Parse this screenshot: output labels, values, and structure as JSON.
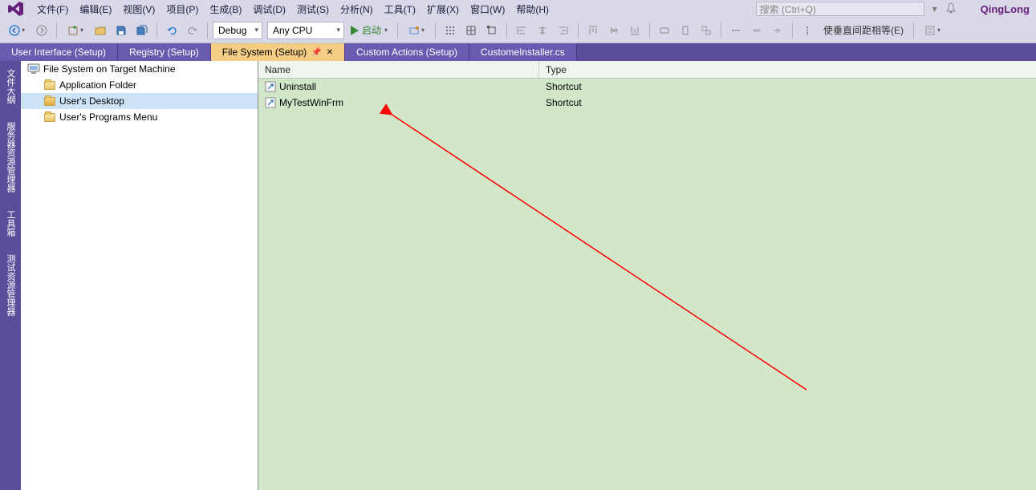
{
  "menu": {
    "items": [
      "文件(F)",
      "编辑(E)",
      "视图(V)",
      "项目(P)",
      "生成(B)",
      "调试(D)",
      "测试(S)",
      "分析(N)",
      "工具(T)",
      "扩展(X)",
      "窗口(W)",
      "帮助(H)"
    ],
    "search_placeholder": "搜索 (Ctrl+Q)",
    "user": "QingLong"
  },
  "toolbar": {
    "config": "Debug",
    "platform": "Any CPU",
    "start": "启动",
    "align_label": "使垂直间距相等(E)"
  },
  "tabs": [
    {
      "label": "User Interface (Setup)",
      "active": false
    },
    {
      "label": "Registry (Setup)",
      "active": false
    },
    {
      "label": "File System (Setup)",
      "active": true
    },
    {
      "label": "Custom Actions (Setup)",
      "active": false
    },
    {
      "label": "CustomeInstaller.cs",
      "active": false
    }
  ],
  "rail": {
    "items": [
      "文件大纲",
      "服务器资源管理器",
      "工具箱",
      "测试资源管理器"
    ]
  },
  "tree": {
    "root": "File System on Target Machine",
    "children": [
      {
        "label": "Application Folder",
        "selected": false
      },
      {
        "label": "User's Desktop",
        "selected": true
      },
      {
        "label": "User's Programs Menu",
        "selected": false
      }
    ]
  },
  "list": {
    "columns": {
      "name": "Name",
      "type": "Type"
    },
    "rows": [
      {
        "name": "Uninstall",
        "type": "Shortcut"
      },
      {
        "name": "MyTestWinFrm",
        "type": "Shortcut"
      }
    ]
  }
}
